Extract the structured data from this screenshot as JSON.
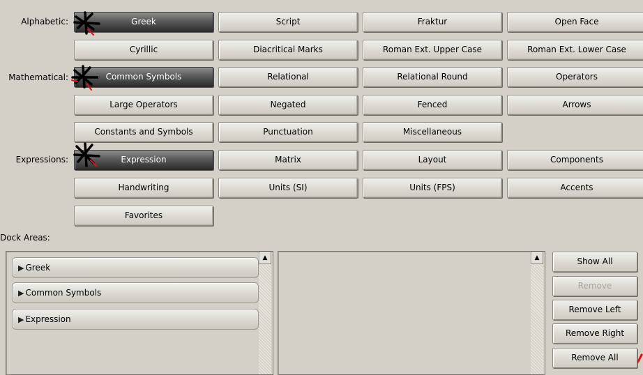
{
  "categories": {
    "alphabetic_label": "Alphabetic:",
    "mathematical_label": "Mathematical:",
    "expressions_label": "Expressions:",
    "greek": "Greek",
    "script": "Script",
    "fraktur": "Fraktur",
    "open_face": "Open Face",
    "cyrillic": "Cyrillic",
    "diacritical_marks": "Diacritical Marks",
    "roman_ext_upper": "Roman Ext. Upper Case",
    "roman_ext_lower": "Roman Ext. Lower Case",
    "common_symbols": "Common Symbols",
    "relational": "Relational",
    "relational_round": "Relational Round",
    "operators": "Operators",
    "large_operators": "Large Operators",
    "negated": "Negated",
    "fenced": "Fenced",
    "arrows": "Arrows",
    "constants_symbols": "Constants and Symbols",
    "punctuation": "Punctuation",
    "miscellaneous": "Miscellaneous",
    "expression": "Expression",
    "matrix": "Matrix",
    "layout": "Layout",
    "components": "Components",
    "handwriting": "Handwriting",
    "units_si": "Units (SI)",
    "units_fps": "Units (FPS)",
    "accents": "Accents",
    "favorites": "Favorites"
  },
  "dock": {
    "label": "Dock Areas:",
    "items": [
      "Greek",
      "Common Symbols",
      "Expression"
    ]
  },
  "actions": {
    "show_all": "Show All",
    "remove": "Remove",
    "remove_left": "Remove Left",
    "remove_right": "Remove Right",
    "remove_all": "Remove All"
  },
  "icons": {
    "selected_marker": "star-icon",
    "expand": "triangle-right-icon",
    "scroll_up": "arrow-up-icon"
  },
  "colors": {
    "background": "#d4d0c8",
    "selected_button": "#3c3c3c",
    "marker_black": "#000000",
    "marker_red": "#e0101a"
  }
}
